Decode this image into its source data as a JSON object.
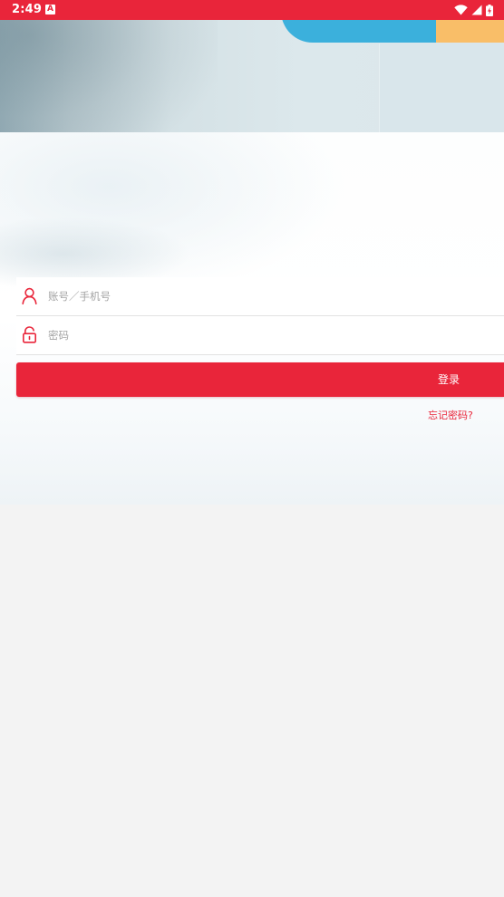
{
  "status_bar": {
    "time": "2:49",
    "notification_glyph": "A",
    "icons": [
      "wifi-icon",
      "cellular-signal-icon",
      "battery-charging-icon"
    ]
  },
  "login": {
    "account_placeholder": "账号／手机号",
    "password_placeholder": "密码",
    "submit_label": "登录",
    "forgot_label": "忘记密码?"
  },
  "colors": {
    "accent": "#e9253a",
    "banner_blue": "#3bb0dc",
    "banner_orange": "#f9be68",
    "page_background": "#f3f3f3"
  }
}
